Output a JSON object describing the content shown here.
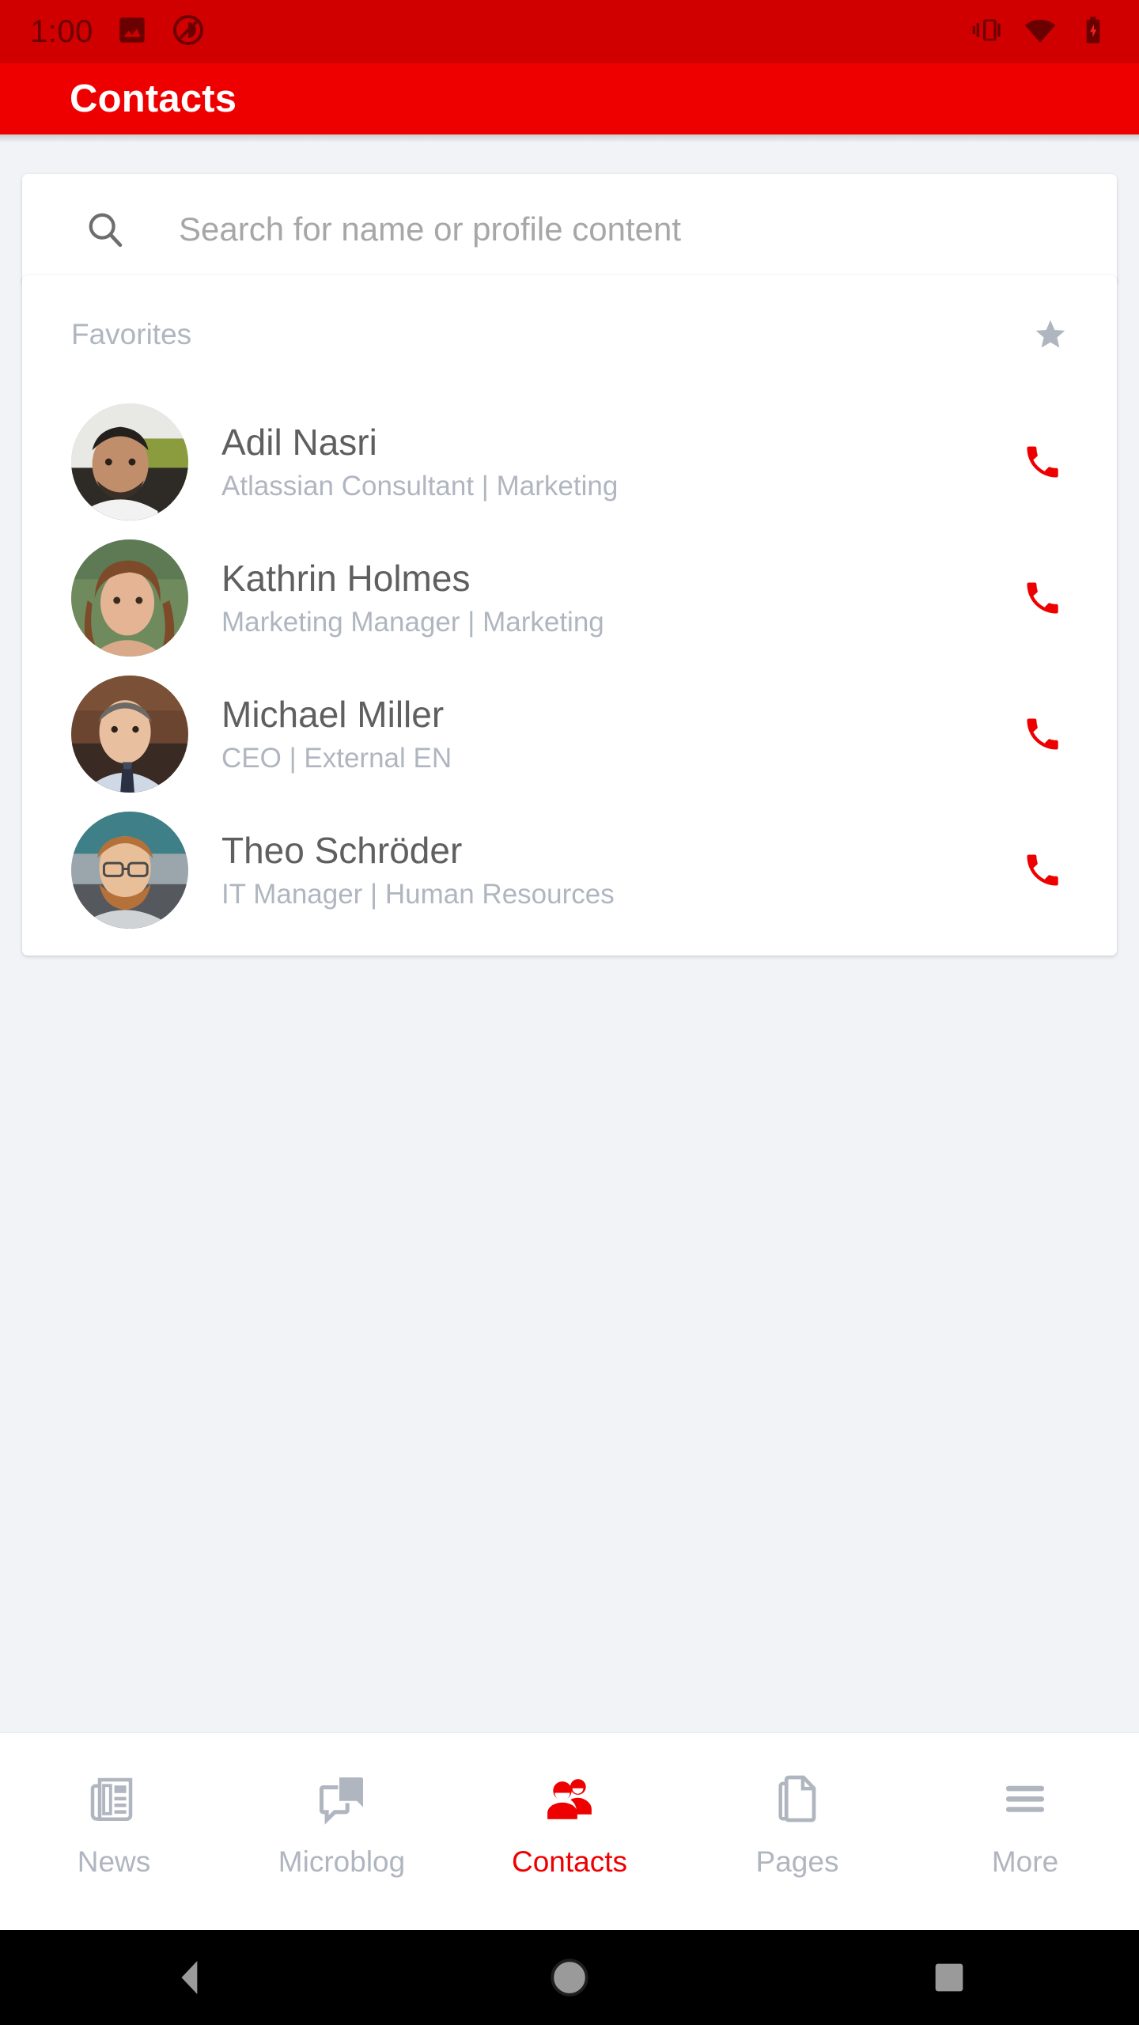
{
  "status_bar": {
    "time": "1:00",
    "left_icons": [
      "image-icon",
      "do-not-disturb-icon"
    ],
    "right_icons": [
      "vibrate-icon",
      "wifi-icon",
      "battery-charging-icon"
    ],
    "background_color": "#d00000",
    "icon_color": "#6b0000"
  },
  "app_bar": {
    "title": "Contacts",
    "background_color": "#ee0000",
    "title_color": "#ffffff"
  },
  "search": {
    "placeholder": "Search for name or profile content",
    "value": "",
    "icon": "search-icon"
  },
  "favorites": {
    "section_label": "Favorites",
    "section_icon": "star-icon",
    "contacts": [
      {
        "name": "Adil Nasri",
        "subtitle": "Atlassian Consultant | Marketing",
        "action_icon": "phone-icon",
        "avatar": "photo-adil-nasri"
      },
      {
        "name": "Kathrin Holmes",
        "subtitle": "Marketing Manager | Marketing",
        "action_icon": "phone-icon",
        "avatar": "photo-kathrin-holmes"
      },
      {
        "name": "Michael Miller",
        "subtitle": "CEO | External EN",
        "action_icon": "phone-icon",
        "avatar": "photo-michael-miller"
      },
      {
        "name": "Theo Schröder",
        "subtitle": "IT Manager | Human Resources",
        "action_icon": "phone-icon",
        "avatar": "photo-theo-schroeder"
      }
    ]
  },
  "bottom_nav": {
    "active_index": 2,
    "active_color": "#ee0000",
    "inactive_color": "#b0b6c0",
    "items": [
      {
        "label": "News",
        "icon": "newspaper-icon"
      },
      {
        "label": "Microblog",
        "icon": "speech-bubble-icon"
      },
      {
        "label": "Contacts",
        "icon": "people-icon"
      },
      {
        "label": "Pages",
        "icon": "document-icon"
      },
      {
        "label": "More",
        "icon": "hamburger-menu-icon"
      }
    ]
  },
  "android_nav": {
    "back": "back-triangle-icon",
    "home": "home-circle-icon",
    "recents": "recents-square-icon"
  }
}
